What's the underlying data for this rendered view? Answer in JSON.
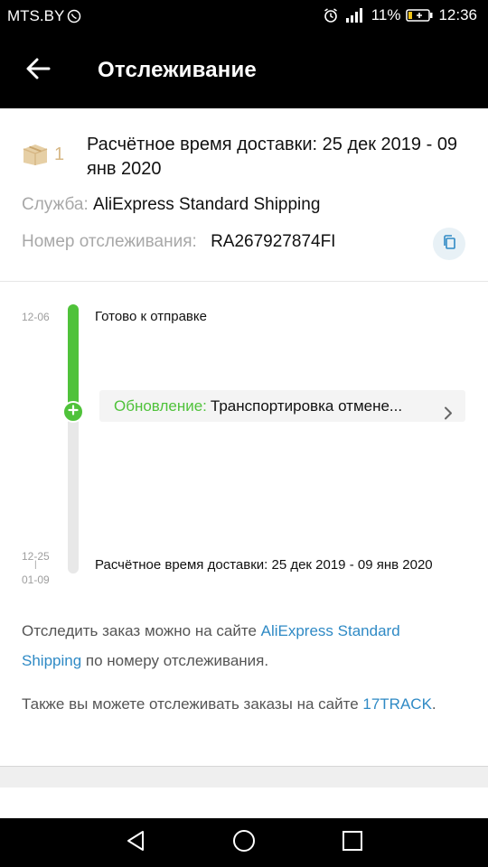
{
  "status_bar": {
    "carrier": "MTS.BY",
    "battery_percent": "11%",
    "time": "12:36"
  },
  "app_bar": {
    "title": "Отслеживание"
  },
  "summary": {
    "package_count": "1",
    "estimated_delivery": "Расчётное время доставки: 25 дек 2019 - 09 янв 2020",
    "service_label": "Служба:",
    "service_value": "AliExpress Standard Shipping",
    "tracking_label": "Номер отслеживания:",
    "tracking_value": "RA267927874FI"
  },
  "timeline": {
    "progress": 0.4,
    "events": [
      {
        "date": "12-06",
        "text": "Готово к отправке"
      }
    ],
    "update": {
      "label": "Обновление:",
      "text": "Транспортировка отмене..."
    },
    "estimate": {
      "date_from": "12-25",
      "date_to": "01-09",
      "text": "Расчётное время доставки: 25 дек 2019 - 09 янв 2020"
    }
  },
  "info": {
    "line1_prefix": "Отследить заказ можно на сайте ",
    "line1_link": "AliExpress Standard Shipping",
    "line1_suffix": " по номеру отслеживания.",
    "line2_prefix": "Также вы можете отслеживать заказы на сайте ",
    "line2_link": "17TRACK",
    "line2_suffix": "."
  },
  "colors": {
    "accent_green": "#4fc23a",
    "link_blue": "#2f8ac5",
    "package_tan": "#d7b886"
  },
  "icons": {
    "back": "arrow-left-icon",
    "package": "package-box-icon",
    "copy": "copy-icon",
    "update_chevron": "chevron-right-icon",
    "nav_back": "triangle-back-icon",
    "nav_home": "circle-home-icon",
    "nav_recent": "square-recent-icon"
  }
}
